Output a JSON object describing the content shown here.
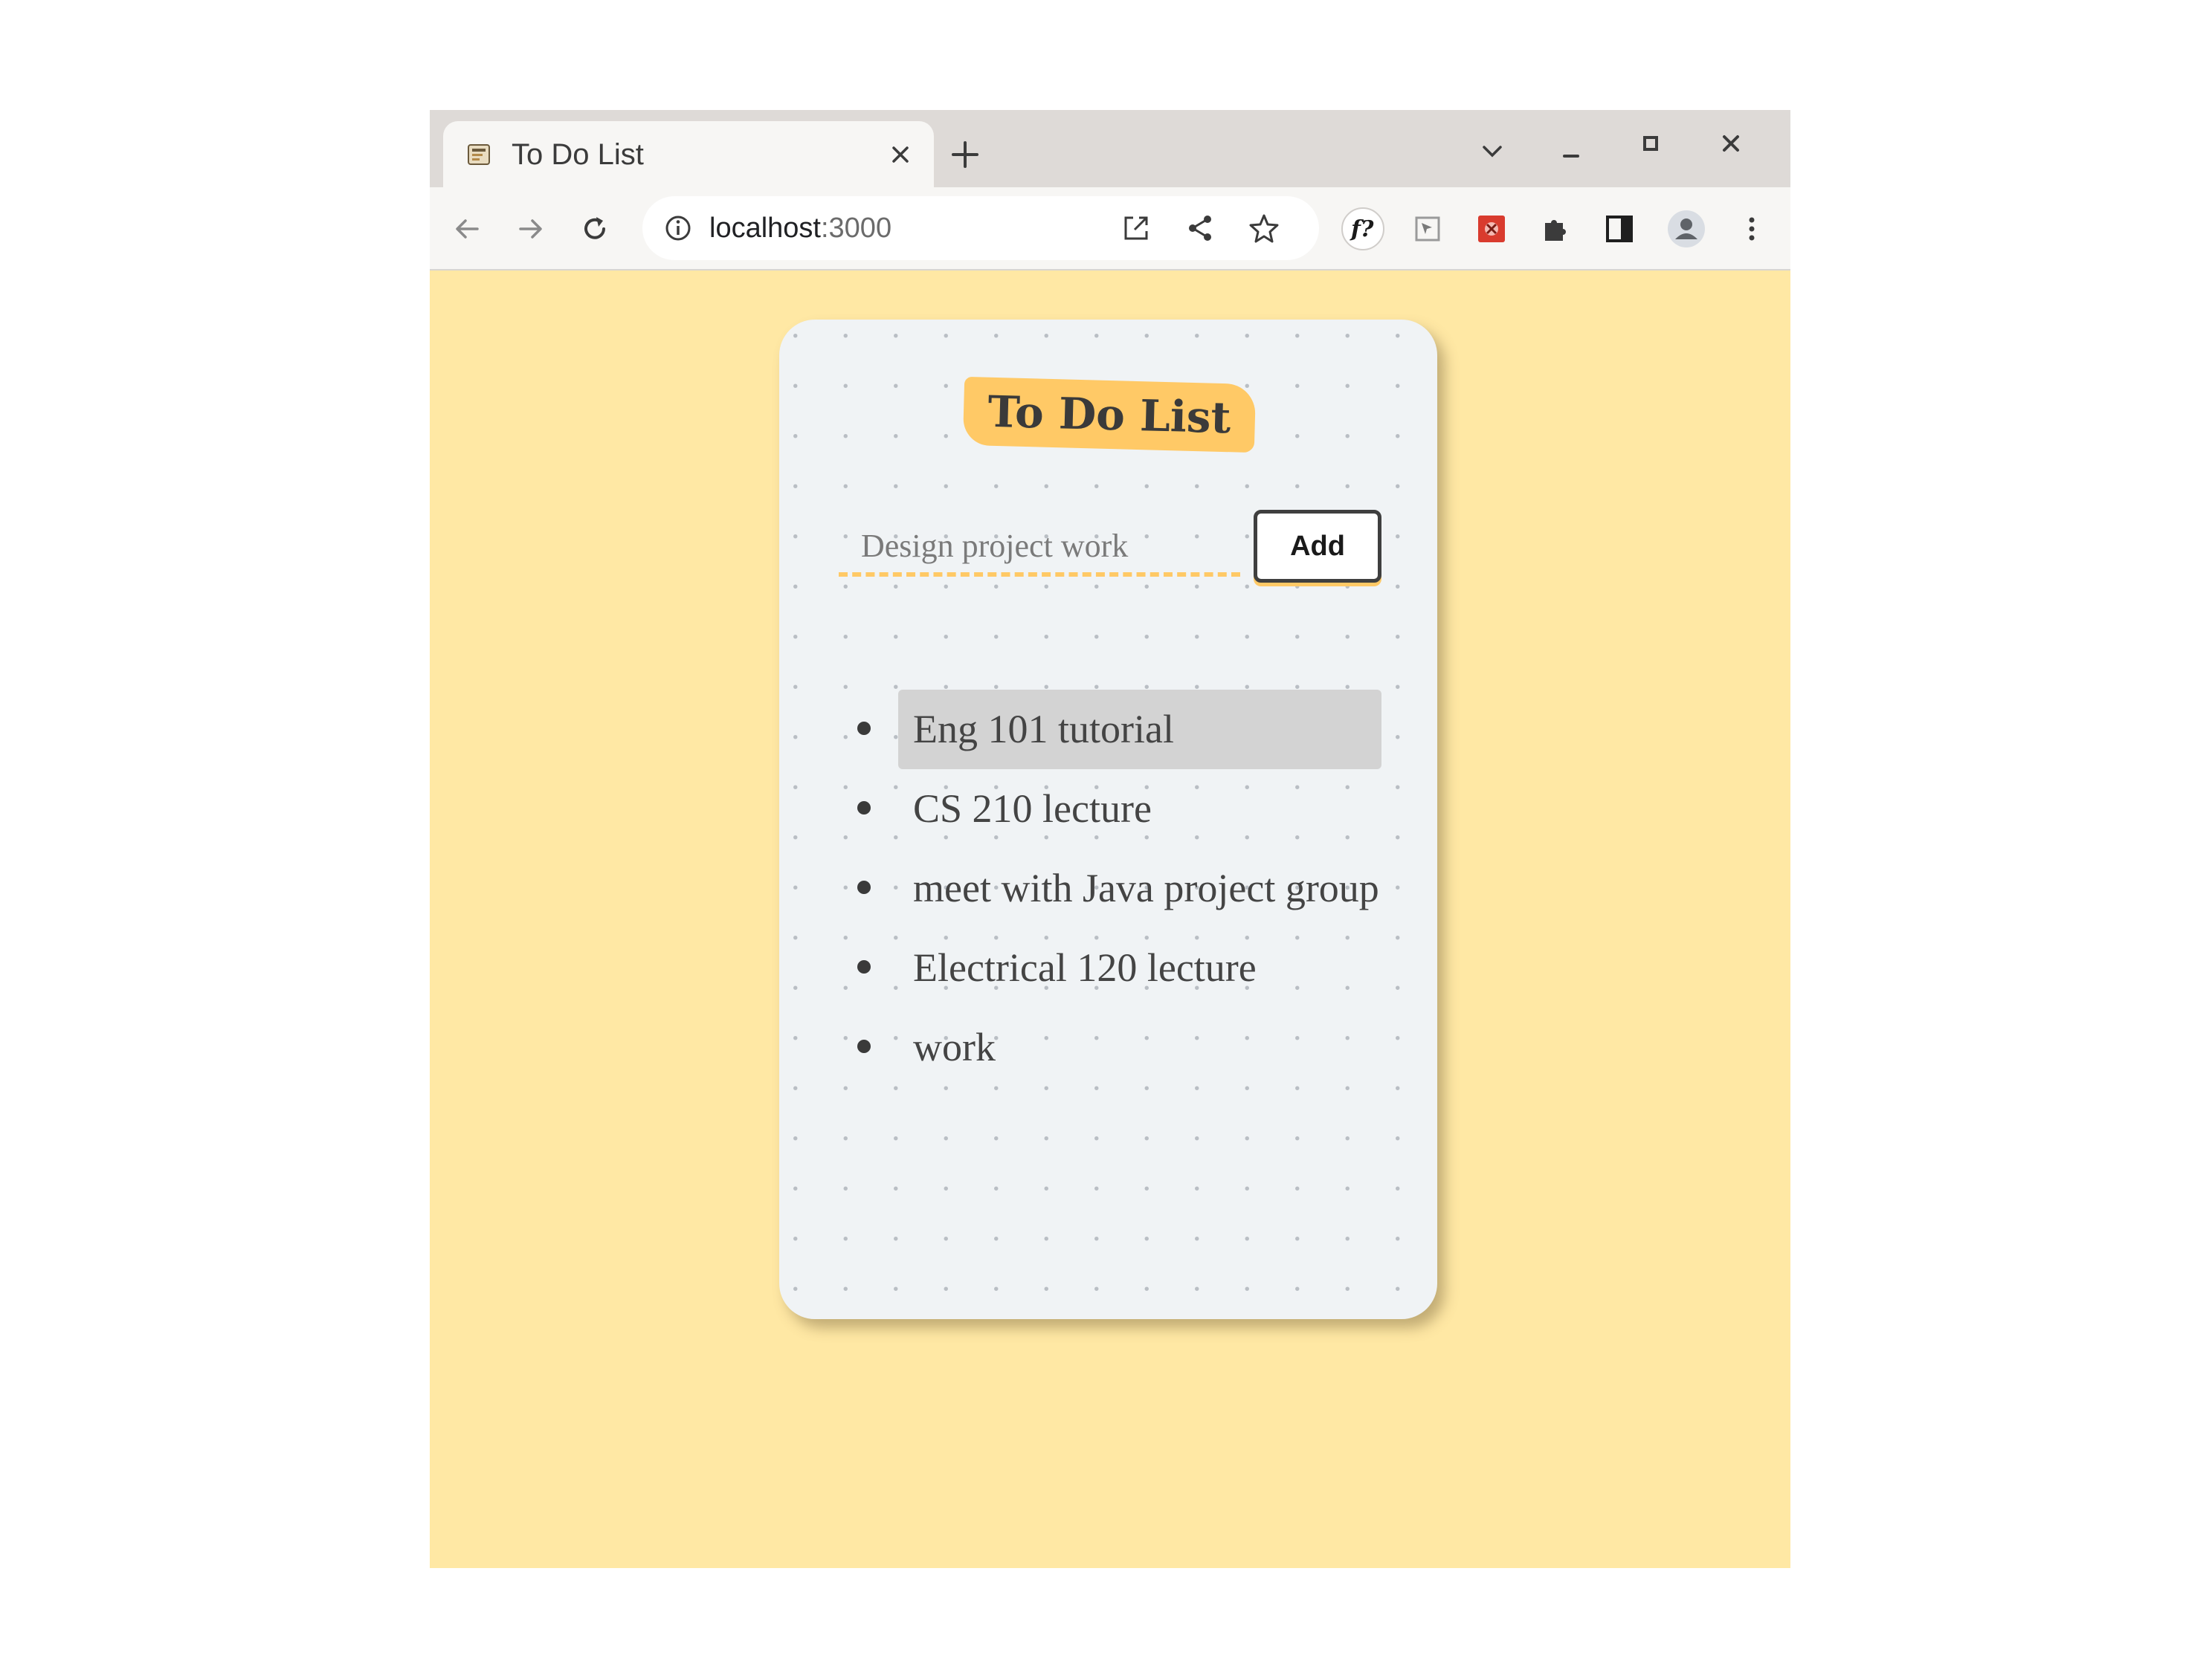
{
  "browser": {
    "tab_title": "To Do List",
    "url_host": "localhost",
    "url_port": ":3000",
    "icons": {
      "tab_favicon": "app-favicon",
      "tab_close": "close-icon",
      "new_tab": "plus-icon",
      "tab_search": "chevron-down-icon",
      "minimize": "minimize-icon",
      "maximize": "maximize-icon",
      "close_window": "close-icon",
      "back": "back-arrow-icon",
      "forward": "forward-arrow-icon",
      "reload": "reload-icon",
      "site_info": "info-icon",
      "open_in_app": "open-external-icon",
      "share": "share-icon",
      "bookmark": "star-icon",
      "extensions": [
        "function-extension-icon",
        "cursor-extension-icon",
        "red-extension-icon",
        "puzzle-icon"
      ],
      "side_panel": "side-panel-icon",
      "profile": "profile-icon",
      "menu": "kebab-menu-icon"
    }
  },
  "app": {
    "title": "To Do List",
    "input_placeholder": "Design project work",
    "add_label": "Add",
    "tasks": [
      "Eng 101 tutorial",
      "CS 210 lecture",
      "meet with Java project group",
      "Electrical 120 lecture",
      "work"
    ],
    "highlighted_index": 0
  },
  "colors": {
    "page_background": "#ffe8a4",
    "card_background": "#f0f3f5",
    "accent": "#ffc966",
    "highlight": "#d3d3d3"
  }
}
